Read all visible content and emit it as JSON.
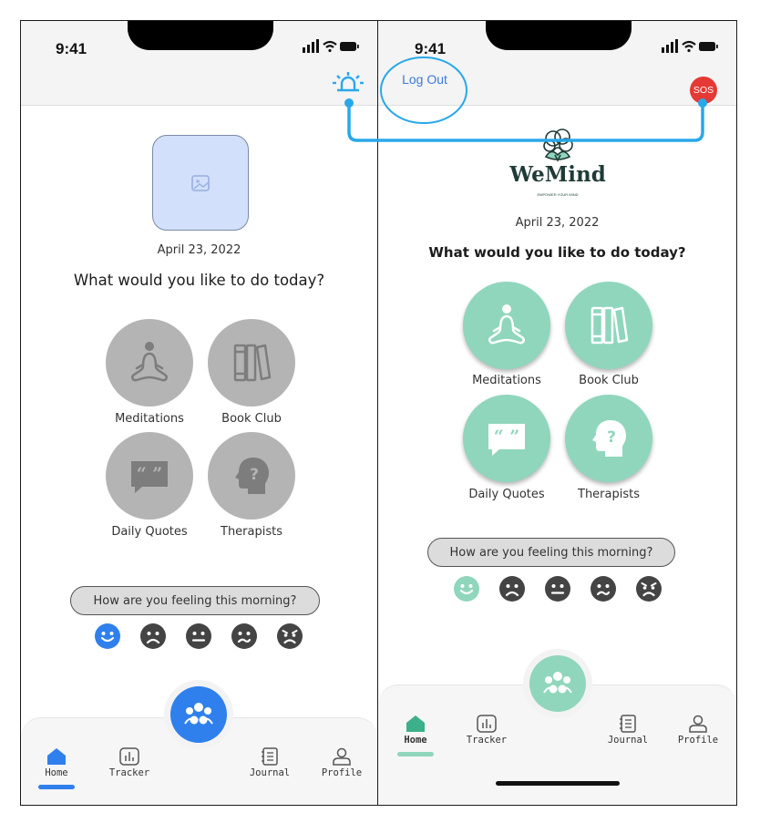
{
  "left": {
    "time": "9:41",
    "date": "April 23, 2022",
    "question": "What would you like to do today?",
    "tiles": [
      {
        "label": "Meditations",
        "icon": "meditation-icon"
      },
      {
        "label": "Book Club",
        "icon": "books-icon"
      },
      {
        "label": "Daily Quotes",
        "icon": "quote-icon"
      },
      {
        "label": "Therapists",
        "icon": "head-question-icon"
      }
    ],
    "mood_prompt": "How are you feeling this morning?",
    "moods": [
      "happy",
      "sad",
      "neutral",
      "confused",
      "angry"
    ],
    "selected_mood": "happy",
    "tabs": [
      {
        "label": "Home",
        "icon": "home-icon"
      },
      {
        "label": "Tracker",
        "icon": "chart-icon"
      },
      {
        "label": "Journal",
        "icon": "journal-icon"
      },
      {
        "label": "Profile",
        "icon": "person-icon"
      }
    ],
    "accent": "#2f80ed",
    "icon_grey": "#b4b4b4"
  },
  "right": {
    "time": "9:41",
    "logout_label": "Log Out",
    "sos_label": "SOS",
    "brand_name": "WeMind",
    "brand_tagline": "EMPOWER YOUR MIND",
    "date": "April 23, 2022",
    "question": "What would you like to do today?",
    "tiles": [
      {
        "label": "Meditations",
        "icon": "meditation-icon"
      },
      {
        "label": "Book Club",
        "icon": "books-icon"
      },
      {
        "label": "Daily Quotes",
        "icon": "quote-icon"
      },
      {
        "label": "Therapists",
        "icon": "head-question-icon"
      }
    ],
    "mood_prompt": "How are you feeling this morning?",
    "moods": [
      "happy",
      "sad",
      "neutral",
      "confused",
      "angry"
    ],
    "selected_mood": "happy",
    "tabs": [
      {
        "label": "Home",
        "icon": "home-icon"
      },
      {
        "label": "Tracker",
        "icon": "chart-icon"
      },
      {
        "label": "Journal",
        "icon": "journal-icon"
      },
      {
        "label": "Profile",
        "icon": "person-icon"
      }
    ],
    "accent": "#8fd6bd",
    "sos_color": "#e53935"
  },
  "annotation_color": "#29a8e8"
}
